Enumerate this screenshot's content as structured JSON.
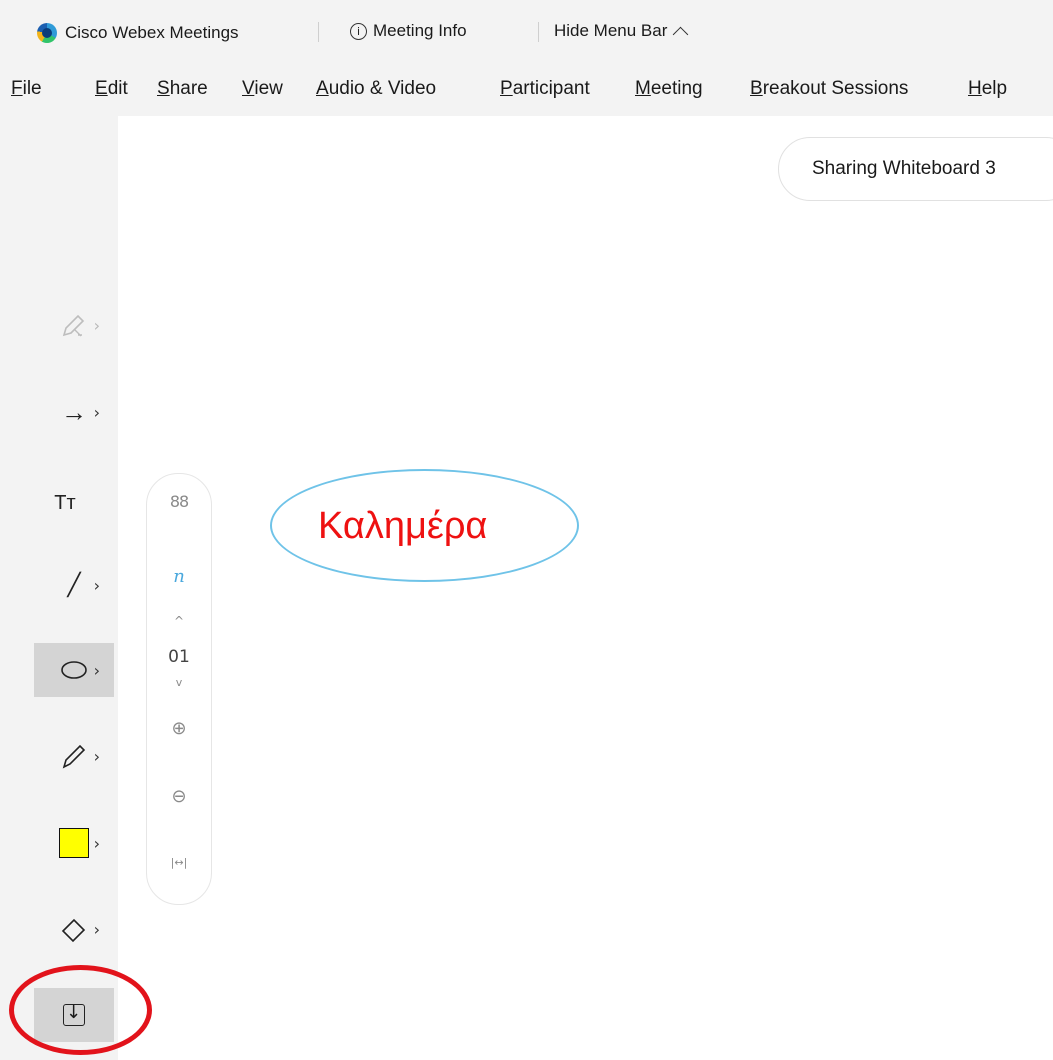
{
  "titlebar": {
    "app_name": "Cisco Webex Meetings",
    "meeting_info": "Meeting Info",
    "info_glyph": "i",
    "hide_menu": "Hide Menu Bar"
  },
  "menu": [
    {
      "ul": "F",
      "rest": "ile"
    },
    {
      "ul": "E",
      "rest": "dit"
    },
    {
      "ul": "S",
      "rest": "hare"
    },
    {
      "ul": "V",
      "rest": "iew"
    },
    {
      "ul": "A",
      "rest": "udio & Video"
    },
    {
      "ul": "P",
      "rest": "articipant"
    },
    {
      "ul": "M",
      "rest": "eeting"
    },
    {
      "ul": "B",
      "rest": "reakout Sessions"
    },
    {
      "ul": "H",
      "rest": "elp"
    }
  ],
  "sharing": {
    "label": "Sharing Whiteboard 3"
  },
  "tools": {
    "pen_disabled_icon": "pen-disabled-icon",
    "arrow_glyph": "→",
    "text_glyph": "Tт",
    "line_glyph": "╱",
    "ellipse_glyph": "◯",
    "pencil_glyph": "✎",
    "eraser_glyph": "◇",
    "chevron": "›",
    "fill_color": "#ffff00"
  },
  "pagenav": {
    "grid_glyph": "88",
    "page_number": "01",
    "up": "^",
    "down": "v",
    "zoom_in": "⊕",
    "zoom_out": "⊖",
    "fit": "|↔|",
    "ink_glyph": "n"
  },
  "annotation": {
    "text": "Καλημέρα",
    "text_color": "#ee1111",
    "border_color": "#6fc3e8"
  },
  "highlight_color": "#e2131b"
}
